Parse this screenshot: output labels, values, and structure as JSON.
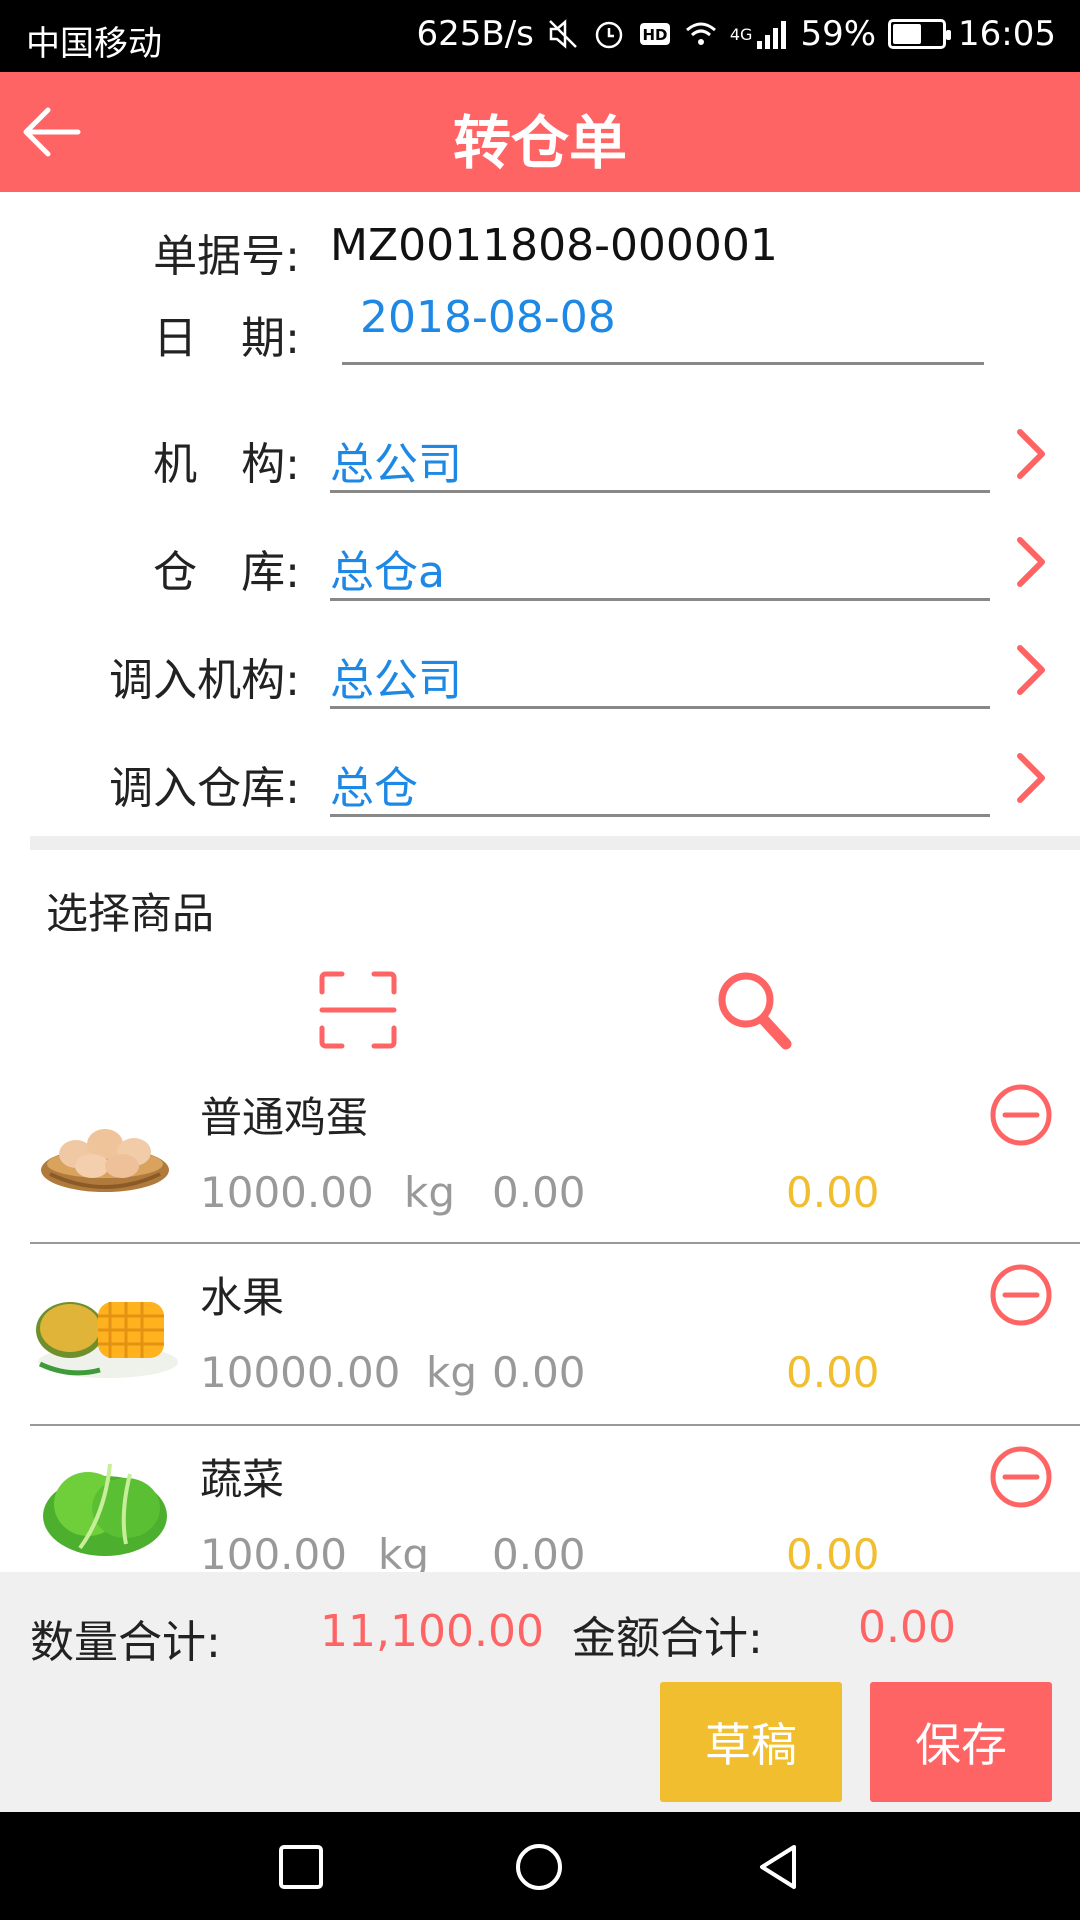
{
  "status_bar": {
    "carrier": "中国移动",
    "net_speed": "625B/s",
    "network": "4G",
    "battery": "59%",
    "battery_level": 0.59,
    "time": "16:05"
  },
  "app_bar": {
    "title": "转仓单"
  },
  "form": {
    "doc_no": {
      "label": "单据号:",
      "value": "MZ0011808-000001"
    },
    "date": {
      "label": "日　期:",
      "value": "2018-08-08"
    },
    "org": {
      "label": "机　构:",
      "value": "总公司"
    },
    "warehouse": {
      "label": "仓　库:",
      "value": "总仓a"
    },
    "in_org": {
      "label": "调入机构:",
      "value": "总公司"
    },
    "in_warehouse": {
      "label": "调入仓库:",
      "value": "总仓"
    }
  },
  "products": {
    "section_title": "选择商品",
    "items": [
      {
        "name": "普通鸡蛋",
        "qty": "1000.00",
        "unit": "kg",
        "price": "0.00",
        "amount": "0.00"
      },
      {
        "name": "水果",
        "qty": "10000.00",
        "unit": "kg",
        "price": "0.00",
        "amount": "0.00"
      },
      {
        "name": "蔬菜",
        "qty": "100.00",
        "unit": "kg",
        "price": "0.00",
        "amount": "0.00"
      }
    ]
  },
  "footer": {
    "qty_total_label": "数量合计:",
    "qty_total": "11,100.00",
    "amount_total_label": "金额合计:",
    "amount_total": "0.00",
    "draft_label": "草稿",
    "save_label": "保存"
  },
  "colors": {
    "accent": "#ff6464",
    "link_blue": "#1e88e5",
    "amount_yellow": "#f0be2e"
  }
}
